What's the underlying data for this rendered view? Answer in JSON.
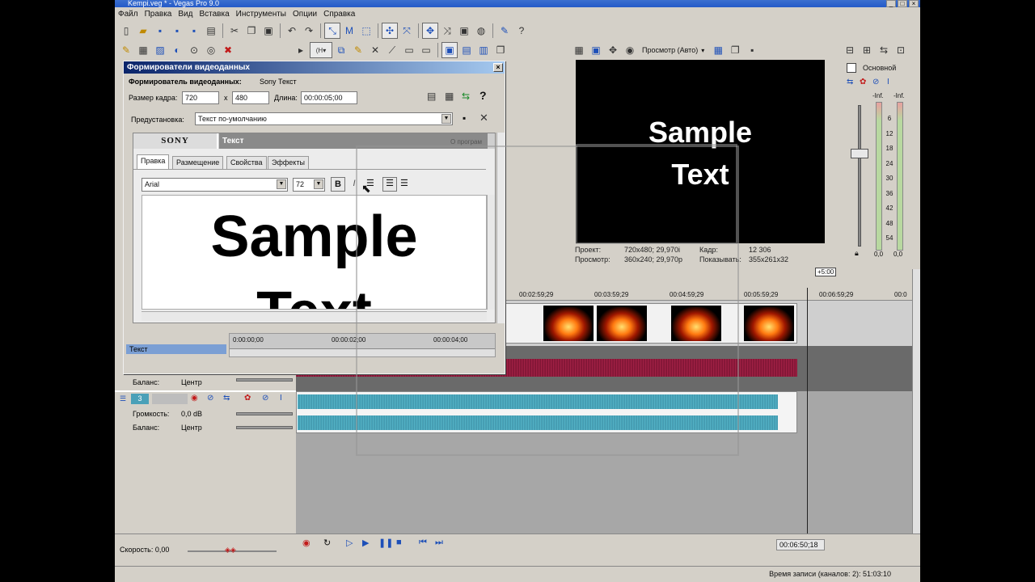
{
  "window": {
    "title": "Kempi.veg * - Vegas Pro 9.0"
  },
  "menu": [
    "Файл",
    "Правка",
    "Вид",
    "Вставка",
    "Инструменты",
    "Опции",
    "Справка"
  ],
  "dialog": {
    "title": "Формирователи видеоданных",
    "subtitle_label": "Формирователь видеоданных:",
    "subtitle_value": "Sony Текст",
    "frame_size_label": "Размер кадра:",
    "width": "720",
    "x_label": "x",
    "height": "480",
    "length_label": "Длина:",
    "length": "00:00:05;00",
    "preset_label": "Предустановка:",
    "preset": "Текст по-умолчанию",
    "plugin_brand": "SONY",
    "plugin_name": "Текст",
    "about": "О програм",
    "tabs": [
      "Правка",
      "Размещение",
      "Свойства",
      "Эффекты"
    ],
    "active_tab": 0,
    "font": "Arial",
    "size": "72",
    "bold_label": "B",
    "italic_label": "I",
    "text_line1": "Sample",
    "text_line2": "Text",
    "keyframe_track": "Текст",
    "ruler": [
      "0:00:00;00",
      "00:00:02;00",
      "00:00:04;00"
    ]
  },
  "preview": {
    "dropdown": "Просмотр (Авто)",
    "line1": "Sample",
    "line2": "Text",
    "project_label": "Проект:",
    "project_value": "720x480; 29,970i",
    "preview_label": "Просмотр:",
    "preview_value": "360x240; 29,970p",
    "frame_label": "Кадр:",
    "frame_value": "12 306",
    "display_label": "Показывать:",
    "display_value": "355x261x32"
  },
  "mixer": {
    "bus_label": "Основной",
    "inf_left": "-Inf.",
    "inf_right": "-Inf.",
    "scale": [
      "6",
      "12",
      "18",
      "24",
      "30",
      "36",
      "42",
      "48",
      "54"
    ],
    "bottom_left": "0,0",
    "bottom_right": "0,0"
  },
  "timeline": {
    "offset_badge": "+5:00",
    "ruler": [
      "00:02:59;29",
      "00:03:59;29",
      "00:04:59;29",
      "00:05:59;29",
      "00:06:59;29",
      "00:0"
    ],
    "track3_number": "3",
    "balance_label": "Баланс:",
    "balance_value": "Центр",
    "volume_label": "Громкость:",
    "volume_value": "0,0 dB",
    "balance2_label": "Баланс:",
    "balance2_value": "Центр",
    "rate_label": "Скорость: 0,00",
    "timecode": "00:06:50;18"
  },
  "status": {
    "text": "Время записи (каналов: 2): 51:03:10"
  },
  "colors": {
    "accent_title": "#0a246a",
    "audio_red": "#b01848",
    "audio_teal": "#4ab0c4"
  }
}
